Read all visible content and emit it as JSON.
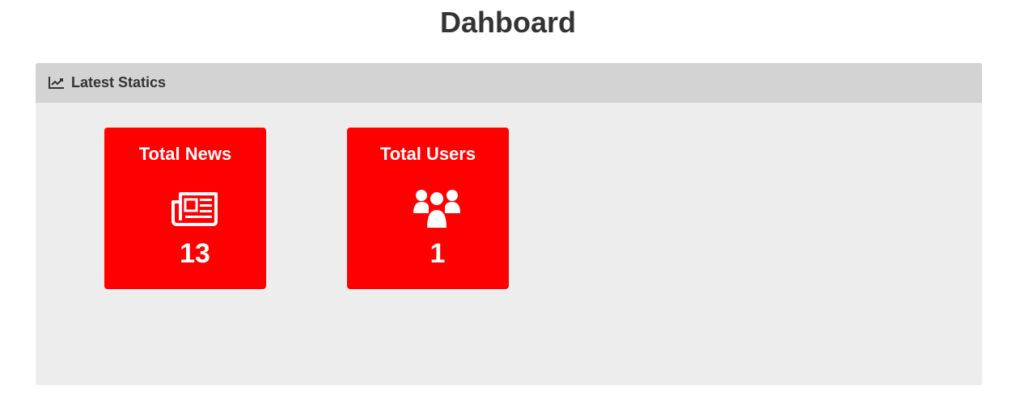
{
  "page": {
    "title": "Dahboard"
  },
  "panel": {
    "heading_icon": "line-chart-icon",
    "heading": "Latest Statics"
  },
  "cards": [
    {
      "label": "Total News",
      "icon": "newspaper-icon",
      "value": "13"
    },
    {
      "label": "Total Users",
      "icon": "users-icon",
      "value": "1"
    }
  ],
  "colors": {
    "card_background": "#ff0000",
    "panel_heading": "#d3d3d3",
    "panel_body": "#ededed",
    "title_text": "#333333"
  }
}
